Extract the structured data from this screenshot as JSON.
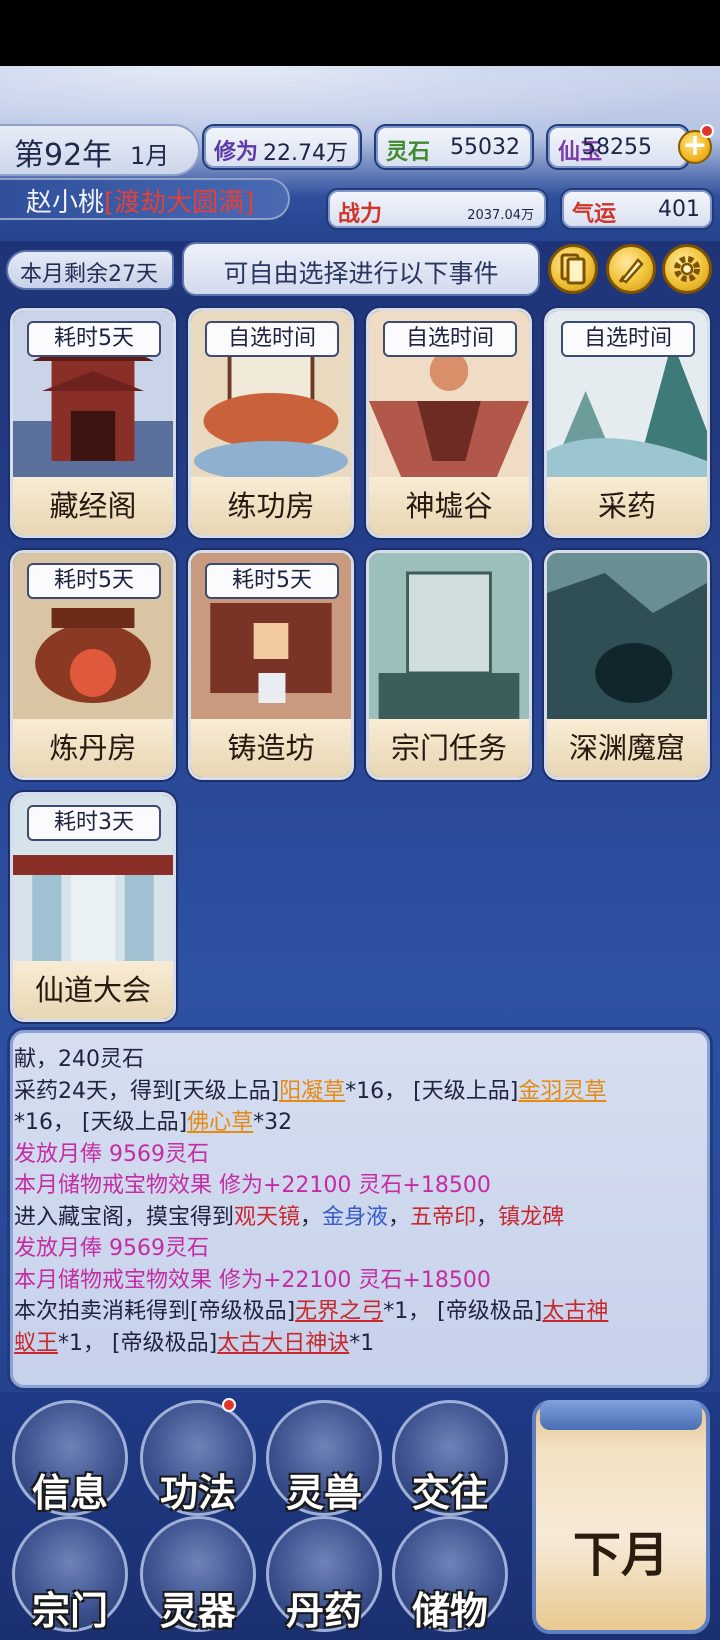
{
  "header": {
    "year": "第92年",
    "month": "1月",
    "resources": {
      "cultivation": {
        "label": "修为",
        "value": "22.74万",
        "color": "#5b3aa8"
      },
      "spirit_stone": {
        "label": "灵石",
        "value": "55032",
        "color": "#3f8a2e"
      },
      "jade": {
        "label": "仙玉",
        "value": "58255",
        "color": "#7b3aa8"
      },
      "power": {
        "label": "战力",
        "value": "2037.04万",
        "color": "#d0352b"
      },
      "fortune": {
        "label": "气运",
        "value": "401",
        "color": "#d0352b"
      }
    },
    "player_name": "赵小桃",
    "realm": "[渡劫大圆满]"
  },
  "event_bar": {
    "days_left": "本月剩余27天",
    "prompt": "可自由选择进行以下事件"
  },
  "icons": [
    "cards-icon",
    "brush-icon",
    "gear-icon"
  ],
  "events": [
    {
      "name": "藏经阁",
      "time": "耗时5天"
    },
    {
      "name": "练功房",
      "time": "自选时间"
    },
    {
      "name": "神墟谷",
      "time": "自选时间"
    },
    {
      "name": "采药",
      "time": "自选时间"
    },
    {
      "name": "炼丹房",
      "time": "耗时5天"
    },
    {
      "name": "铸造坊",
      "time": "耗时5天"
    },
    {
      "name": "宗门任务",
      "time": ""
    },
    {
      "name": "深渊魔窟",
      "time": ""
    },
    {
      "name": "仙道大会",
      "time": "耗时3天"
    }
  ],
  "log": {
    "l1": "献，240灵石",
    "l2a": "采药24天，得到[天级上品]",
    "l2b": "阳凝草",
    "l2c": "*16，  [天级上品]",
    "l2d": "金羽灵草",
    "l3a": "*16，  [天级上品]",
    "l3b": "佛心草",
    "l3c": "*32",
    "l4": "发放月俸 9569灵石",
    "l5": "本月储物戒宝物效果 修为+22100 灵石+18500",
    "l6a": "进入藏宝阁，摸宝得到",
    "l6b": "观天镜",
    "l6c": "，",
    "l6d": "金身液",
    "l6e": "，",
    "l6f": "五帝印",
    "l6g": "，",
    "l6h": "镇龙碑",
    "l7": "发放月俸 9569灵石",
    "l8": "本月储物戒宝物效果 修为+22100 灵石+18500",
    "l9a": "本次拍卖消耗得到[帝级极品]",
    "l9b": "无界之弓",
    "l9c": "*1，  [帝级极品]",
    "l9d": "太古神",
    "l10a": "蚁王",
    "l10b": "*1，  [帝级极品]",
    "l10c": "太古大日神诀",
    "l10d": "*1"
  },
  "menu": [
    "信息",
    "功法",
    "灵兽",
    "交往",
    "宗门",
    "灵器",
    "丹药",
    "储物"
  ],
  "next_month": "下月"
}
